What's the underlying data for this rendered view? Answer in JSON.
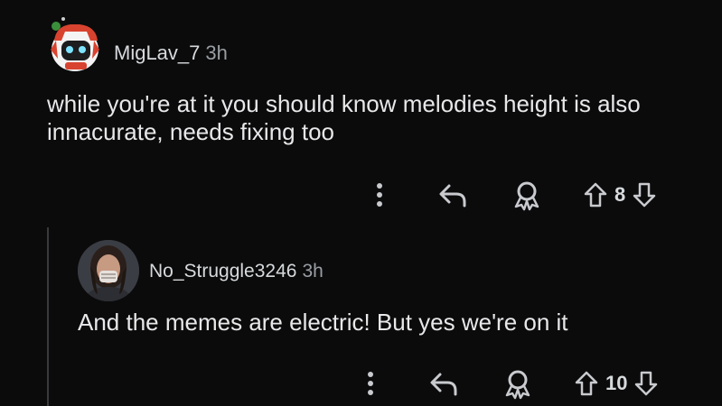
{
  "comments": [
    {
      "username": "MigLav_7",
      "time": "3h",
      "body": "while you're at it you should know melodies height is also innacurate, needs fixing too",
      "vote_count": "8",
      "avatar_icon": "robot-snoo-avatar-icon"
    },
    {
      "username": "No_Struggle3246",
      "time": "3h",
      "body": "And the memes are electric! But yes we're on it",
      "vote_count": "10",
      "avatar_icon": "profile-photo-avatar-icon"
    }
  ],
  "icons": {
    "more": "more-vertical-icon",
    "reply": "reply-icon",
    "award": "award-icon",
    "upvote": "upvote-arrow-icon",
    "downvote": "downvote-arrow-icon"
  },
  "colors": {
    "background": "#0b0b0c",
    "text": "#e8e8ea",
    "muted": "#9a9ea3",
    "thread_line": "#3a3a3e"
  }
}
